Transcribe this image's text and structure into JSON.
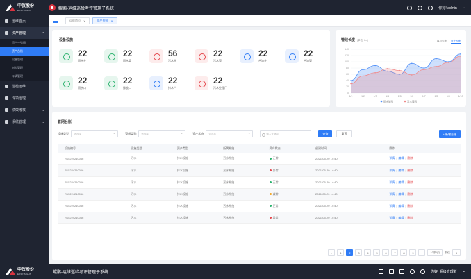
{
  "app": {
    "logo_cn": "中仪股份",
    "logo_en": "EASY-SIGHT",
    "title": "鲲鹏-运维巡检考评管理子系统",
    "user_greeting": "你好! admin",
    "bottom_user_greeting": "你好! 超级管理者"
  },
  "sidebar": {
    "items": [
      {
        "label": "运维首页"
      },
      {
        "label": "资产管理",
        "expanded": true,
        "subitems": [
          {
            "label": "资产一张图"
          },
          {
            "label": "资产台账",
            "active": true
          },
          {
            "label": "设备管理"
          },
          {
            "label": "材料管理"
          },
          {
            "label": "车辆管理"
          }
        ]
      },
      {
        "label": "巡检运维"
      },
      {
        "label": "专项治理"
      },
      {
        "label": "绩效考核"
      },
      {
        "label": "系统管理"
      }
    ]
  },
  "tabs": [
    {
      "label": "运维首页"
    },
    {
      "label": "资产台账",
      "active": true
    }
  ],
  "devices": {
    "title": "设备设施",
    "items": [
      {
        "count": "22",
        "label": "雨水井",
        "color": "#2db36f",
        "bg": "#e6f6ee"
      },
      {
        "count": "22",
        "label": "雨水管",
        "color": "#2db36f",
        "bg": "#e6f6ee"
      },
      {
        "count": "56",
        "label": "污水井",
        "color": "#e5484d",
        "bg": "#fdecec"
      },
      {
        "count": "22",
        "label": "污水管",
        "color": "#e5484d",
        "bg": "#fdecec"
      },
      {
        "count": "22",
        "label": "合流井",
        "color": "#2f7cf6",
        "bg": "#e8f0fe"
      },
      {
        "count": "22",
        "label": "合流管",
        "color": "#2f7cf6",
        "bg": "#e8f0fe"
      },
      {
        "count": "22",
        "label": "雨水口",
        "color": "#2db36f",
        "bg": "#e6f6ee"
      },
      {
        "count": "22",
        "label": "排放口",
        "color": "#2db36f",
        "bg": "#e6f6ee"
      },
      {
        "count": "22",
        "label": "排水户",
        "color": "#2f7cf6",
        "bg": "#e8f0fe"
      },
      {
        "count": "22",
        "label": "污水处理厂",
        "color": "#e5484d",
        "bg": "#fdecec"
      }
    ]
  },
  "chart_panel": {
    "title": "管线长度",
    "unit": "(单位: km)",
    "toggle": [
      "每月长度",
      "累计长度"
    ],
    "toggle_active": 1
  },
  "chart_data": {
    "type": "area",
    "x": [
      "1/1",
      "1/2",
      "1/3",
      "1/4",
      "1/5",
      "1/6",
      "1/7",
      "1/8",
      "1/9",
      "1/10"
    ],
    "ylim": [
      0,
      140
    ],
    "yticks": [
      0,
      20,
      40,
      60,
      80,
      100,
      120,
      140
    ],
    "series": [
      {
        "name": "雨水管网",
        "color": "#4f8ff7",
        "values": [
          40,
          75,
          88,
          70,
          60,
          95,
          80,
          110,
          100,
          125
        ]
      },
      {
        "name": "污水管网",
        "color": "#f08a8a",
        "values": [
          30,
          55,
          65,
          78,
          72,
          58,
          75,
          85,
          98,
          118
        ]
      }
    ],
    "legend": "bottom"
  },
  "table": {
    "title": "管网台账",
    "filters": [
      {
        "label": "设施类型:",
        "placeholder": "请选择"
      },
      {
        "label": "管线类别:",
        "placeholder": "请选择"
      },
      {
        "label": "资产状态:",
        "placeholder": "请选择"
      }
    ],
    "search_placeholder": "输入关键词",
    "search_btn": "查询",
    "reset_btn": "重置",
    "add_btn": "+ 新增台账",
    "columns": [
      "设施编号",
      "设施类型",
      "资产类型",
      "所属系统",
      "资产状态",
      "创建时间",
      "操作"
    ],
    "rows": [
      {
        "id": "R15224210066",
        "type": "污水",
        "asset": "排水设施",
        "system": "污水系统",
        "status": "正常",
        "status_color": "#2db36f",
        "time": "2021-05-20 14:40"
      },
      {
        "id": "R15224210066",
        "type": "污水",
        "asset": "排水设施",
        "system": "污水系统",
        "status": "异常",
        "status_color": "#e5484d",
        "time": "2021-05-20 14:40"
      },
      {
        "id": "R15224210066",
        "type": "污水",
        "asset": "排水设施",
        "system": "污水系统",
        "status": "正常",
        "status_color": "#2db36f",
        "time": "2021-05-20 14:40"
      },
      {
        "id": "R15224210066",
        "type": "污水",
        "asset": "排水设施",
        "system": "污水系统",
        "status": "减常",
        "status_color": "#f5a623",
        "time": "2021-05-20 14:40"
      },
      {
        "id": "R15224210066",
        "type": "污水",
        "asset": "排水设施",
        "system": "污水系统",
        "status": "正常",
        "status_color": "#2db36f",
        "time": "2021-05-20 14:40"
      },
      {
        "id": "R15224210066",
        "type": "污水",
        "asset": "排水设施",
        "system": "污水系统",
        "status": "异常",
        "status_color": "#e5484d",
        "time": "2021-05-20 14:40"
      }
    ],
    "actions": [
      "详情",
      "编辑",
      "删除"
    ]
  },
  "pager": {
    "pages": [
      "1",
      "2",
      "3",
      "4",
      "5",
      "6",
      "7",
      "8",
      "9"
    ],
    "active": "2",
    "page_size": "10条/页",
    "goto_label": "前往",
    "goto_value": "5"
  }
}
